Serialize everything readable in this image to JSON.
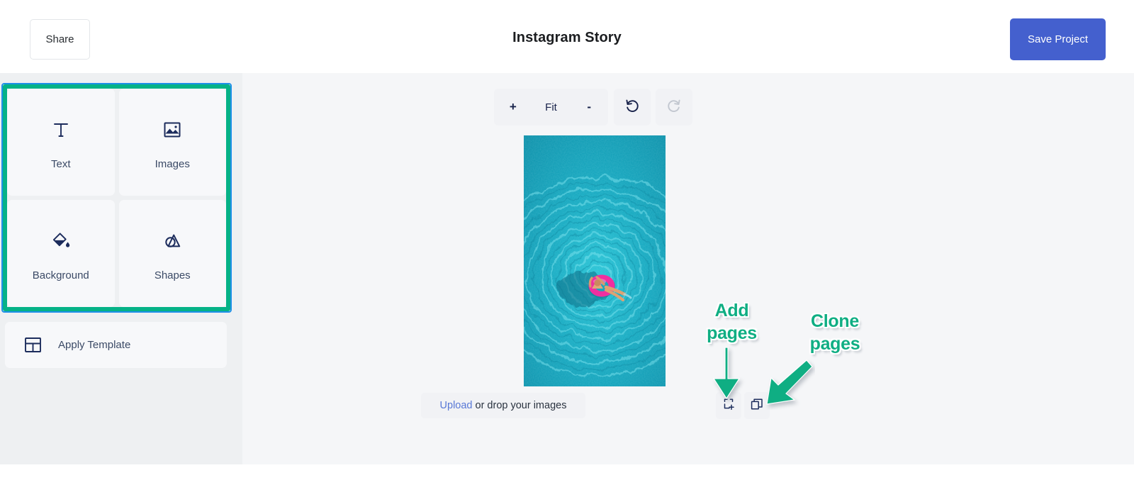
{
  "header": {
    "share_label": "Share",
    "title": "Instagram Story",
    "save_label": "Save Project"
  },
  "sidebar": {
    "tools": [
      {
        "label": "Text",
        "icon": "text-icon"
      },
      {
        "label": "Images",
        "icon": "image-icon"
      },
      {
        "label": "Background",
        "icon": "paint-bucket-icon"
      },
      {
        "label": "Shapes",
        "icon": "shapes-icon"
      }
    ],
    "apply_template_label": "Apply Template",
    "selection_highlight_color": "#05b287",
    "selection_focus_color": "#1e90e8"
  },
  "canvas": {
    "zoom_toolbar": {
      "zoom_in_label": "+",
      "fit_label": "Fit",
      "zoom_out_label": "-",
      "undo_icon": "undo-icon",
      "redo_icon": "redo-icon"
    },
    "upload": {
      "link_label": "Upload",
      "rest_label": "or drop your images"
    },
    "artboard": {
      "description": "Aerial photo of turquoise swimming pool water with a person floating on a pink ring",
      "water_color": "#15a6bd",
      "float_color": "#ef2fa0"
    },
    "page_actions": [
      {
        "name": "add-page",
        "icon": "page-plus-icon"
      },
      {
        "name": "clone-page",
        "icon": "copy-pages-icon"
      }
    ]
  },
  "annotations": [
    {
      "text": "Add\npages",
      "color": "#0fae83",
      "arrow": "arrow-down"
    },
    {
      "text": "Clone\npages",
      "color": "#0fae83",
      "arrow": "arrow-down-left"
    }
  ]
}
